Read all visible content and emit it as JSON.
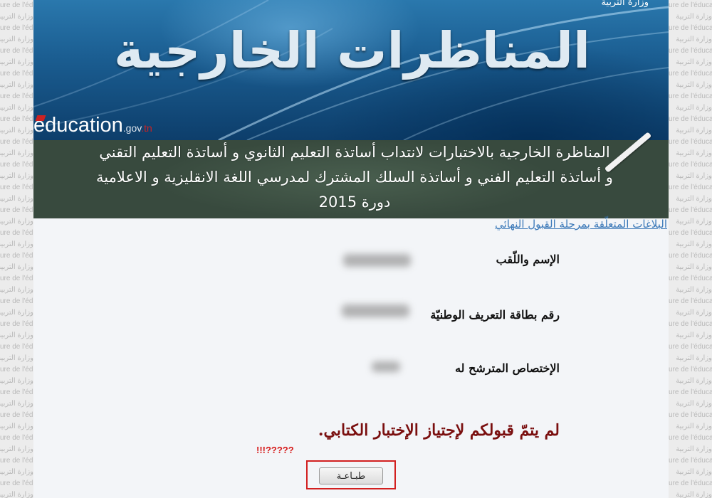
{
  "watermark": {
    "lines": [
      "ure de l'éducation",
      "وزارة التربية"
    ]
  },
  "banner": {
    "ministry": "وزارة التربية",
    "title": "المناظرات الخارجية",
    "logo": {
      "main": "education",
      "gov": ".gov",
      "tn": ".tn"
    }
  },
  "board": {
    "line1": "المناظرة الخارجية بالاختبارات لانتداب أساتذة التعليم الثانوي و أساتذة التعليم التقني",
    "line2": "و أساتذة التعليم الفني و أساتذة السلك المشترك لمدرسي اللغة الانقليزية و الاعلامية",
    "line3": "دورة 2015"
  },
  "notice_link": "البلاغات المتعلّقة بمرحلة القبول النهائي",
  "fields": {
    "name_label": "الإسم واللّقب",
    "id_label": "رقم بطاقة التعريف الوطنيّة",
    "specialty_label": "الإختصاص المترشح له"
  },
  "result_message": "لم يتمّ قبولكم لإجتياز الإختبار الكتابي.",
  "annotation": "!!!?????",
  "print_button": "طبـاعـة",
  "colors": {
    "result": "#7a0f0f",
    "annotation": "#d61a1a",
    "highlight": "#d22020",
    "link": "#3a78b8"
  }
}
